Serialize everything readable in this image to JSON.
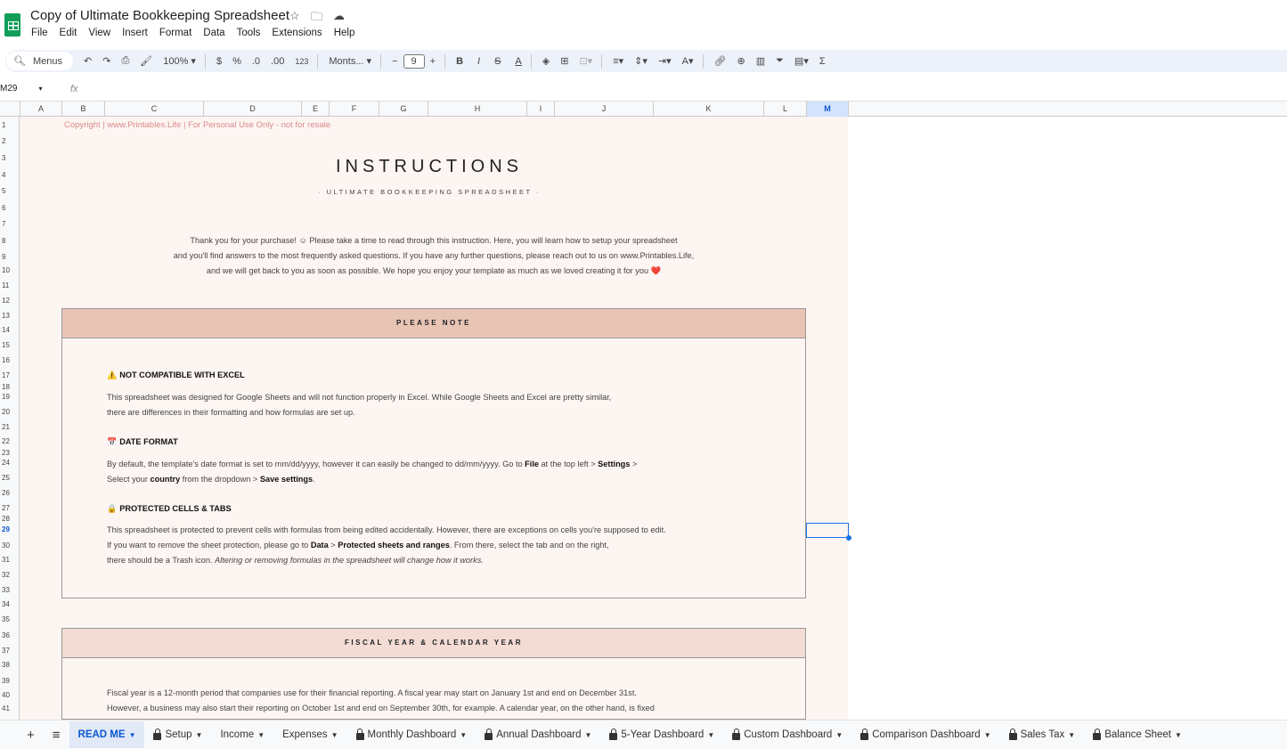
{
  "app": {
    "title": "Copy of Ultimate Bookkeeping Spreadsheet",
    "menu": [
      "File",
      "Edit",
      "View",
      "Insert",
      "Format",
      "Data",
      "Tools",
      "Extensions",
      "Help"
    ]
  },
  "toolbar": {
    "search": "Menus",
    "zoom": "100%",
    "currency": "$",
    "percent": "%",
    "dec_decrease": ".0",
    "dec_increase": ".00",
    "format_number": "123",
    "font": "Monts...",
    "font_size": "9"
  },
  "formula_bar": {
    "cell_ref": "M29",
    "fx": "fx",
    "value": ""
  },
  "columns": [
    "A",
    "B",
    "C",
    "D",
    "E",
    "F",
    "G",
    "H",
    "I",
    "J",
    "K",
    "L",
    "M"
  ],
  "selected_cell": "M29",
  "rows": [
    "1",
    "2",
    "3",
    "4",
    "5",
    "6",
    "7",
    "8",
    "9",
    "10",
    "11",
    "12",
    "13",
    "14",
    "15",
    "16",
    "17",
    "18",
    "19",
    "20",
    "21",
    "22",
    "23",
    "24",
    "25",
    "26",
    "27",
    "28",
    "29",
    "30",
    "31",
    "32",
    "33",
    "34",
    "35",
    "36",
    "37",
    "38",
    "39",
    "40",
    "41"
  ],
  "content": {
    "copyright": "Copyright | www.Printables.Life | For Personal Use Only - not for resale",
    "title": "INSTRUCTIONS",
    "subtitle": "· ULTIMATE BOOKKEEPING SPREADSHEET ·",
    "intro": [
      "Thank you for your purchase! ☺ Please take a time to read through this instruction. Here, you will learn how to setup your spreadsheet",
      "and you'll find answers to the most frequently asked questions. If you have any further questions, please reach out to us on www.Printables.Life,",
      "and we will get back to you as soon as possible. We hope you enjoy your template as much as we loved creating it for you ❤️"
    ],
    "please_note": {
      "header": "PLEASE NOTE",
      "sections": [
        {
          "icon": "⚠️",
          "heading": "NOT COMPATIBLE WITH EXCEL",
          "lines": [
            [
              {
                "t": "This spreadsheet was designed for Google Sheets and will not function properly in Excel. While Google Sheets and Excel are pretty similar,"
              }
            ],
            [
              {
                "t": "there are differences in their formatting and how formulas are set up."
              }
            ]
          ]
        },
        {
          "icon": "📅",
          "heading": "DATE FORMAT",
          "lines": [
            [
              {
                "t": "By default, the template's date format is set to mm/dd/yyyy, however it can easily be changed to dd/mm/yyyy. Go to "
              },
              {
                "t": "File",
                "b": true
              },
              {
                "t": " at the top left > "
              },
              {
                "t": "Settings",
                "b": true
              },
              {
                "t": " >"
              }
            ],
            [
              {
                "t": "Select your "
              },
              {
                "t": "country",
                "b": true
              },
              {
                "t": " from the dropdown > "
              },
              {
                "t": "Save settings",
                "b": true
              },
              {
                "t": "."
              }
            ]
          ]
        },
        {
          "icon": "🔒",
          "heading": "PROTECTED CELLS & TABS",
          "lines": [
            [
              {
                "t": "This spreadsheet is protected to prevent cells with formulas from being edited accidentally. However, there are exceptions on cells you're supposed to edit."
              }
            ],
            [
              {
                "t": "If you want to remove the sheet protection, please go to "
              },
              {
                "t": "Data",
                "b": true
              },
              {
                "t": " > "
              },
              {
                "t": "Protected sheets and ranges",
                "b": true
              },
              {
                "t": ". From there, select the tab and on the right,"
              }
            ],
            [
              {
                "t": "there should be a Trash icon. "
              },
              {
                "t": "Altering or removing formulas in the spreadsheet will change how it works.",
                "i": true
              }
            ]
          ]
        }
      ]
    },
    "fiscal": {
      "header": "FISCAL YEAR & CALENDAR YEAR",
      "lines": [
        "Fiscal year is a 12-month period that companies use for their financial reporting. A fiscal year may start on January 1st and end on December 31st.",
        "However, a business may also start their reporting on October 1st and end on September 30th, for example. A calendar year, on the other hand, is fixed"
      ]
    }
  },
  "tabs": [
    {
      "label": "READ ME",
      "locked": false,
      "active": true
    },
    {
      "label": "Setup",
      "locked": true
    },
    {
      "label": "Income",
      "locked": false
    },
    {
      "label": "Expenses",
      "locked": false
    },
    {
      "label": "Monthly Dashboard",
      "locked": true
    },
    {
      "label": "Annual Dashboard",
      "locked": true
    },
    {
      "label": "5-Year Dashboard",
      "locked": true
    },
    {
      "label": "Custom Dashboard",
      "locked": true
    },
    {
      "label": "Comparison Dashboard",
      "locked": true
    },
    {
      "label": "Sales Tax",
      "locked": true
    },
    {
      "label": "Balance Sheet",
      "locked": true
    }
  ],
  "colors": {
    "note_header": "#e8c4b5",
    "fiscal_header": "#f2dcd3",
    "sheet_bg": "#fcf5f2",
    "copyright": "#d98a8a",
    "selection": "#1a73e8"
  }
}
